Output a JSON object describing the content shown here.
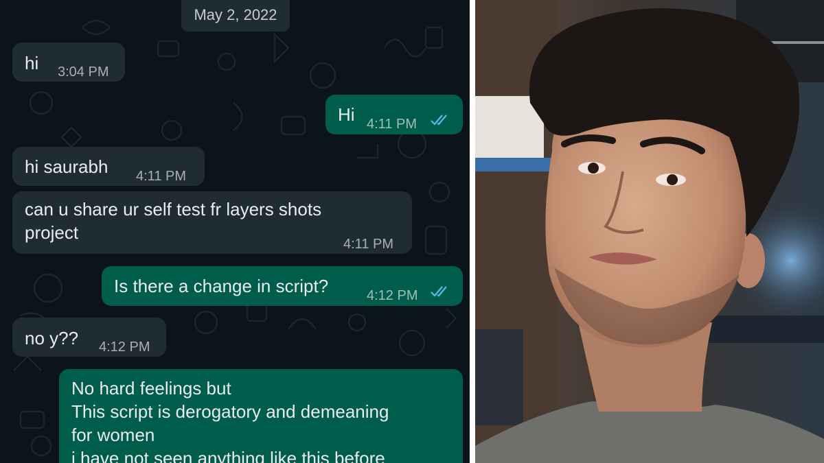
{
  "chat": {
    "date_label": "May 2, 2022",
    "messages": [
      {
        "direction": "incoming",
        "text": "hi",
        "time": "3:04 PM"
      },
      {
        "direction": "outgoing",
        "text": "Hi",
        "time": "4:11 PM",
        "status": "read-double-tick"
      },
      {
        "direction": "incoming",
        "text": "hi saurabh",
        "time": "4:11 PM"
      },
      {
        "direction": "incoming",
        "text": "can u share ur self test fr layers shots\nproject",
        "time": "4:11 PM"
      },
      {
        "direction": "outgoing",
        "text": "Is there a change in script?",
        "time": "4:12 PM",
        "status": "read-double-tick"
      },
      {
        "direction": "incoming",
        "text": "no y??",
        "time": "4:12 PM"
      },
      {
        "direction": "outgoing",
        "text": "No hard feelings but\nThis script is derogatory and demeaning\nfor women\ni have not seen anything  like this before"
      }
    ]
  },
  "photo": {
    "subject": "portrait-photo"
  },
  "colors": {
    "chat_bg": "#0b141a",
    "incoming_bubble": "#1f2c33",
    "outgoing_bubble": "#005c4b",
    "read_tick": "#53bdeb",
    "text": "#e9edef"
  }
}
